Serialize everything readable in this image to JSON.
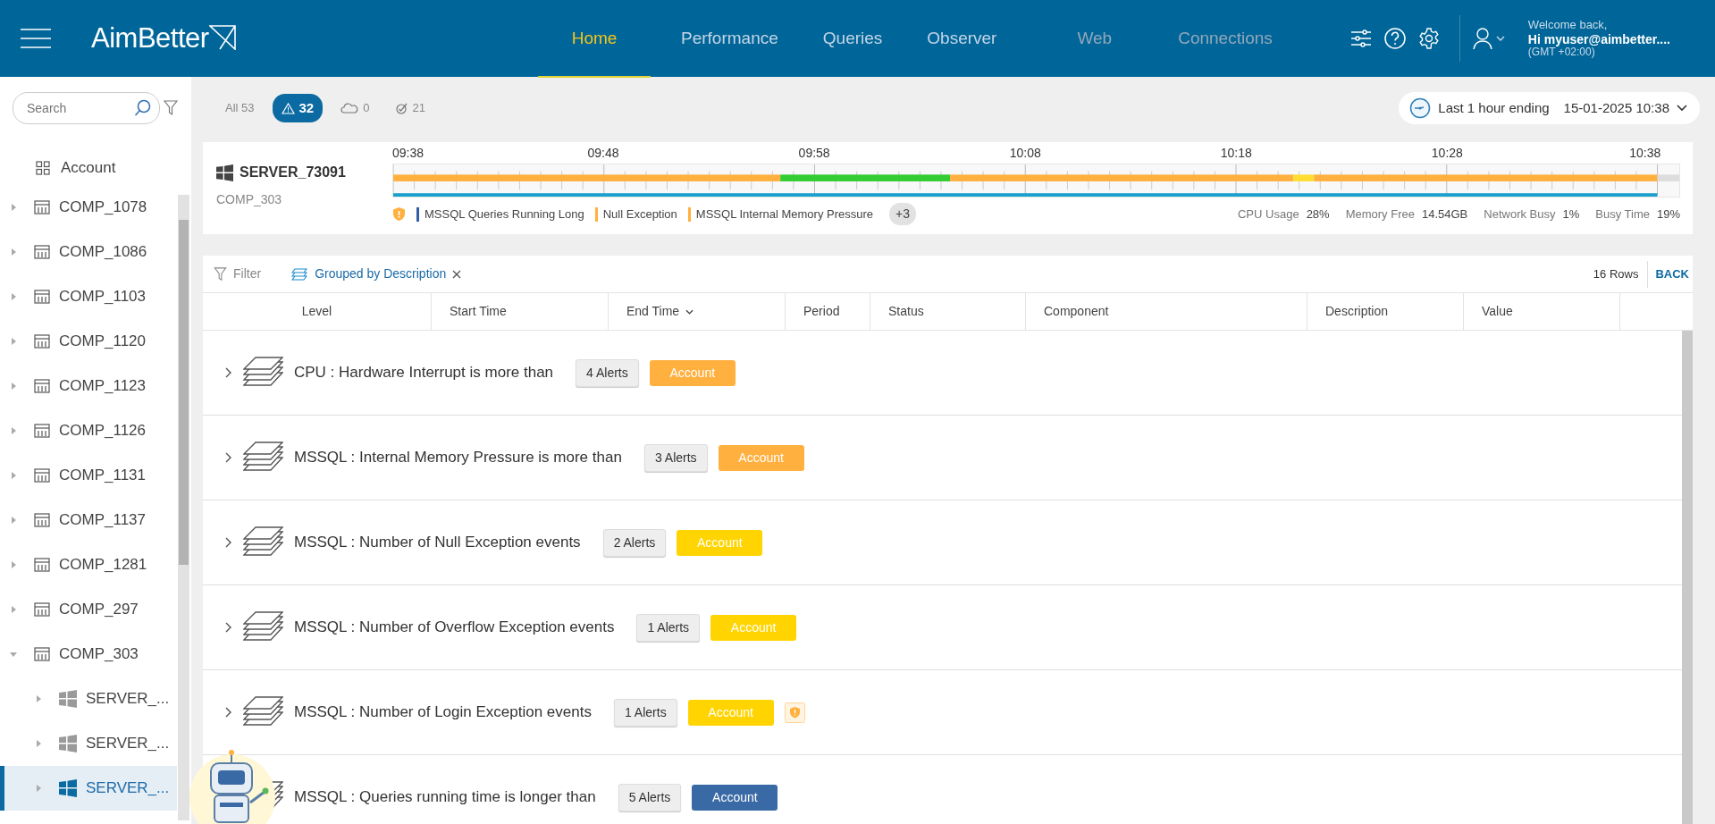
{
  "header": {
    "logo": "AimBetter",
    "nav": [
      {
        "label": "Home",
        "selected": true,
        "disabled": false
      },
      {
        "label": "Performance",
        "selected": false,
        "disabled": false
      },
      {
        "label": "Queries",
        "selected": false,
        "disabled": false
      },
      {
        "label": "Observer",
        "selected": false,
        "disabled": false
      },
      {
        "label": "Web",
        "selected": false,
        "disabled": true
      },
      {
        "label": "Connections",
        "selected": false,
        "disabled": true
      }
    ],
    "user": {
      "greeting": "Welcome back,",
      "name": "Hi myuser@aimbetter....",
      "timezone": "(GMT +02:00)"
    }
  },
  "sidebar": {
    "search": {
      "placeholder": "Search"
    },
    "account": {
      "label": "Account"
    },
    "tree": [
      {
        "label": "COMP_1078",
        "kind": "company",
        "expanded": false,
        "selected": false
      },
      {
        "label": "COMP_1086",
        "kind": "company",
        "expanded": false,
        "selected": false
      },
      {
        "label": "COMP_1103",
        "kind": "company",
        "expanded": false,
        "selected": false
      },
      {
        "label": "COMP_1120",
        "kind": "company",
        "expanded": false,
        "selected": false
      },
      {
        "label": "COMP_1123",
        "kind": "company",
        "expanded": false,
        "selected": false
      },
      {
        "label": "COMP_1126",
        "kind": "company",
        "expanded": false,
        "selected": false
      },
      {
        "label": "COMP_1131",
        "kind": "company",
        "expanded": false,
        "selected": false
      },
      {
        "label": "COMP_1137",
        "kind": "company",
        "expanded": false,
        "selected": false
      },
      {
        "label": "COMP_1281",
        "kind": "company",
        "expanded": false,
        "selected": false
      },
      {
        "label": "COMP_297",
        "kind": "company",
        "expanded": false,
        "selected": false
      },
      {
        "label": "COMP_303",
        "kind": "company",
        "expanded": true,
        "selected": false,
        "children": [
          {
            "label": "SERVER_...",
            "kind": "server",
            "expanded": false,
            "selected": false
          },
          {
            "label": "SERVER_...",
            "kind": "server",
            "expanded": false,
            "selected": false
          },
          {
            "label": "SERVER_...",
            "kind": "server",
            "expanded": false,
            "selected": true
          }
        ]
      }
    ]
  },
  "status_filters": [
    {
      "kind": "all",
      "label": "All 53",
      "selected": false
    },
    {
      "kind": "warning",
      "label": "32",
      "selected": true
    },
    {
      "kind": "cloud",
      "label": "0",
      "selected": false
    },
    {
      "kind": "check",
      "label": "21",
      "selected": false
    }
  ],
  "time_range": {
    "label": "Last 1 hour ending",
    "value": "15-01-2025 10:38"
  },
  "server": {
    "name": "SERVER_73091",
    "company": "COMP_303",
    "time_labels": [
      "09:38",
      "09:48",
      "09:58",
      "10:08",
      "10:18",
      "10:28",
      "10:38"
    ],
    "legend": [
      {
        "label": "MSSQL Queries Running Long",
        "color": "#2f5fa7"
      },
      {
        "label": "Null Exception",
        "color": "#ffb03f"
      },
      {
        "label": "MSSQL Internal Memory Pressure",
        "color": "#ffb03f"
      }
    ],
    "more": "+3",
    "metrics": [
      {
        "label": "CPU Usage",
        "value": "28%"
      },
      {
        "label": "Memory Free",
        "value": "14.54GB"
      },
      {
        "label": "Network Busy",
        "value": "1%"
      },
      {
        "label": "Busy Time",
        "value": "19%"
      }
    ]
  },
  "table": {
    "filter": "Filter",
    "grouping": "Grouped by Description",
    "row_count": "16 Rows",
    "back": "BACK",
    "columns": [
      {
        "label": "Level",
        "sorted": false
      },
      {
        "label": "Start Time",
        "sorted": false
      },
      {
        "label": "End Time",
        "sorted": true
      },
      {
        "label": "Period",
        "sorted": false
      },
      {
        "label": "Status",
        "sorted": false
      },
      {
        "label": "Component",
        "sorted": false
      },
      {
        "label": "Description",
        "sorted": false
      },
      {
        "label": "Value",
        "sorted": false
      }
    ],
    "groups": [
      {
        "title": "CPU : Hardware Interrupt is more than",
        "alerts": "4 Alerts",
        "tag": "Account",
        "color": "#ffb03f",
        "flagged": false
      },
      {
        "title": "MSSQL : Internal Memory Pressure is more than",
        "alerts": "3 Alerts",
        "tag": "Account",
        "color": "#ffb03f",
        "flagged": false
      },
      {
        "title": "MSSQL : Number of Null Exception events",
        "alerts": "2 Alerts",
        "tag": "Account",
        "color": "#ffd400",
        "flagged": false
      },
      {
        "title": "MSSQL : Number of Overflow Exception events",
        "alerts": "1 Alerts",
        "tag": "Account",
        "color": "#ffd400",
        "flagged": false
      },
      {
        "title": "MSSQL : Number of Login Exception events",
        "alerts": "1 Alerts",
        "tag": "Account",
        "color": "#ffd400",
        "flagged": true
      },
      {
        "title": "MSSQL : Queries running time is longer than",
        "alerts": "5 Alerts",
        "tag": "Account",
        "color": "#3a6aa5",
        "flagged": false
      }
    ]
  }
}
